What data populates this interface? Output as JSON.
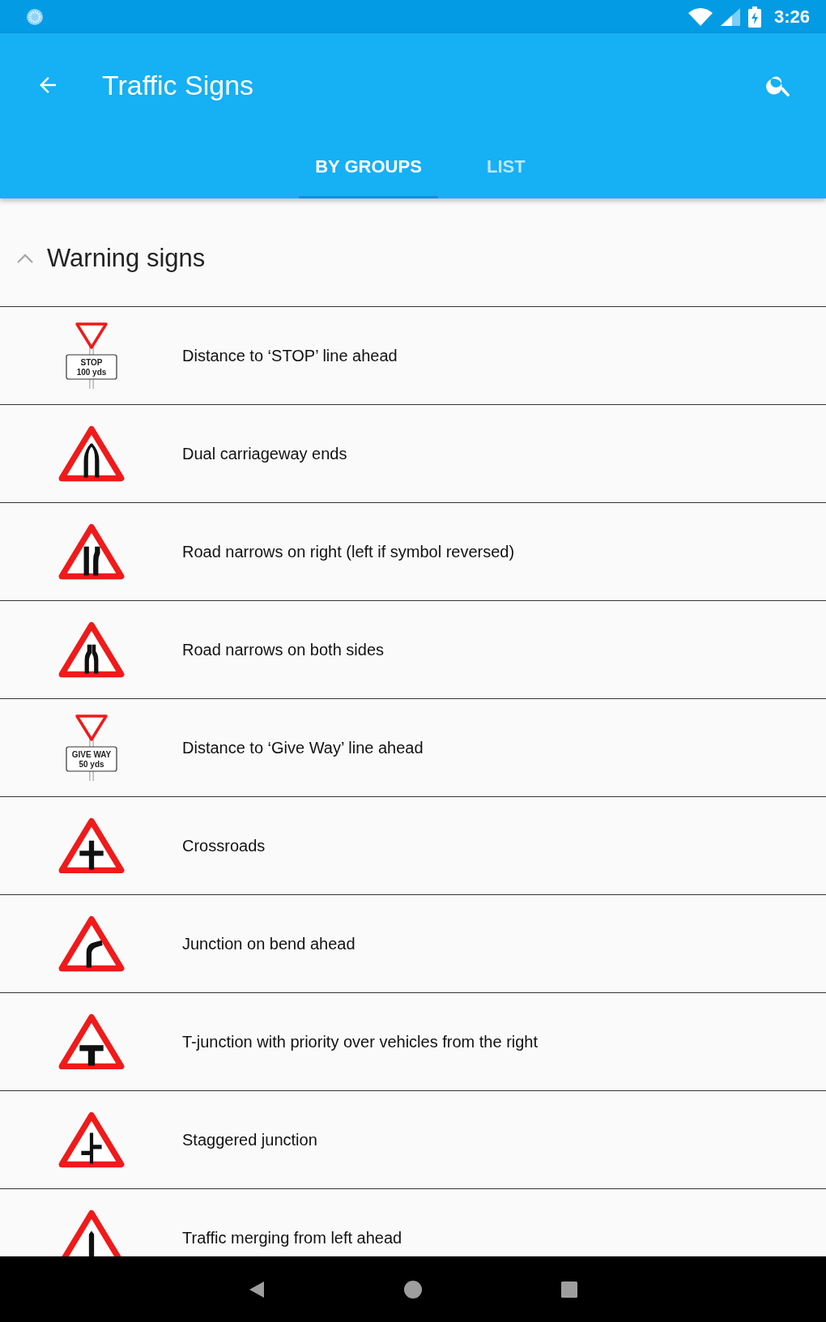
{
  "status_bar": {
    "time": "3:26"
  },
  "app_bar": {
    "title": "Traffic Signs"
  },
  "tabs": [
    {
      "label": "BY GROUPS",
      "selected": true
    },
    {
      "label": "LIST",
      "selected": false
    }
  ],
  "section": {
    "title": "Warning signs",
    "expanded": true
  },
  "signs": [
    {
      "kind": "plate",
      "plate": [
        "STOP",
        "100 yds"
      ],
      "label": "Distance to ‘STOP’ line ahead"
    },
    {
      "kind": "dual_carriageway_ends",
      "label": "Dual carriageway ends"
    },
    {
      "kind": "narrows_right",
      "label": "Road narrows on right (left if symbol reversed)"
    },
    {
      "kind": "narrows_both",
      "label": "Road narrows on both sides"
    },
    {
      "kind": "plate",
      "plate": [
        "GIVE WAY",
        "50 yds"
      ],
      "label": "Distance to ‘Give Way’ line ahead"
    },
    {
      "kind": "crossroads",
      "label": "Crossroads"
    },
    {
      "kind": "junction_bend",
      "label": "Junction on bend ahead"
    },
    {
      "kind": "t_junction",
      "label": "T-junction with priority over vehicles from the right"
    },
    {
      "kind": "staggered",
      "label": "Staggered junction"
    },
    {
      "kind": "merging_left",
      "label": "Traffic merging from left ahead"
    }
  ]
}
